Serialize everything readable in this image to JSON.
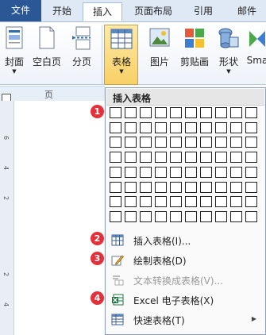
{
  "tabs": [
    {
      "label": "文件"
    },
    {
      "label": "开始"
    },
    {
      "label": "插入"
    },
    {
      "label": "页面布局"
    },
    {
      "label": "引用"
    },
    {
      "label": "邮件"
    }
  ],
  "ribbon": {
    "buttons": [
      {
        "label": "封面"
      },
      {
        "label": "空白页"
      },
      {
        "label": "分页"
      },
      {
        "label": "表格"
      },
      {
        "label": "图片"
      },
      {
        "label": "剪贴画"
      },
      {
        "label": "形状"
      },
      {
        "label": "Sma"
      }
    ],
    "group_label": "页"
  },
  "ruler": {
    "ticks": [
      "6",
      "4",
      "2",
      "2",
      "4"
    ]
  },
  "dropdown": {
    "title": "插入表格",
    "grid": {
      "columns": 10,
      "rows": 8
    },
    "items": [
      {
        "label": "插入表格(I)...",
        "icon": "insert-table-icon",
        "enabled": true,
        "submenu": false
      },
      {
        "label": "绘制表格(D)",
        "icon": "draw-table-pencil-icon",
        "enabled": true,
        "submenu": false
      },
      {
        "label": "文本转换成表格(V)...",
        "icon": "convert-text-icon",
        "enabled": false,
        "submenu": false
      },
      {
        "label": "Excel 电子表格(X)",
        "icon": "excel-sheet-icon",
        "enabled": true,
        "submenu": false
      },
      {
        "label": "快速表格(T)",
        "icon": "quick-table-icon",
        "enabled": true,
        "submenu": true
      }
    ]
  },
  "badges": [
    "1",
    "2",
    "3",
    "4"
  ],
  "colors": {
    "file_tab": "#2b5797",
    "badge": "#e4303a",
    "selected_button": "#f8d065"
  }
}
